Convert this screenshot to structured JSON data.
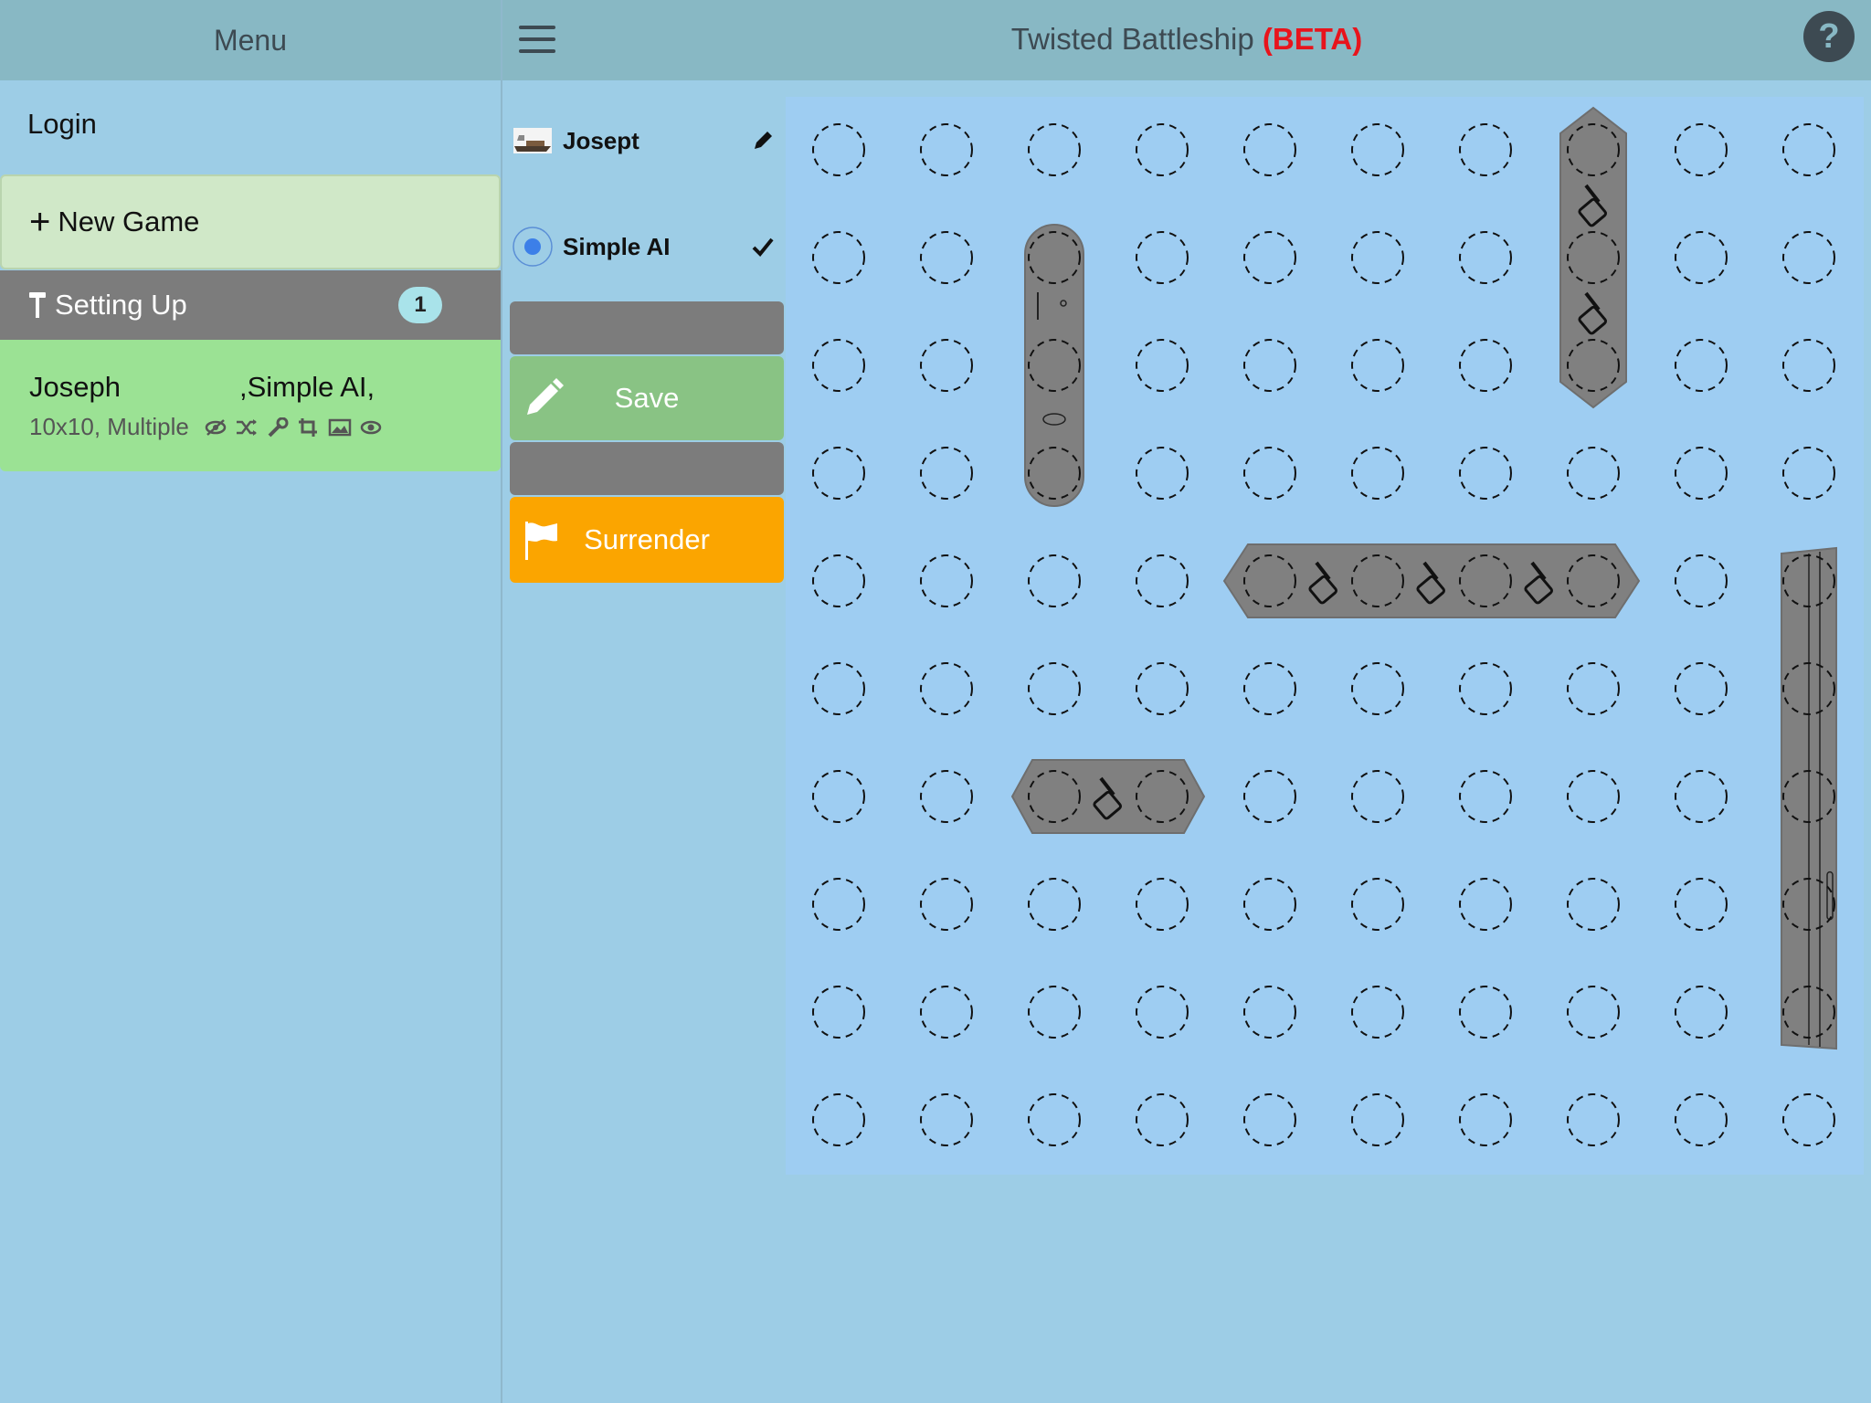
{
  "sidebar": {
    "header": "Menu",
    "login": "Login",
    "new_game": "New Game",
    "setting_up": {
      "label": "Setting Up",
      "count": "1"
    },
    "game_item": {
      "player1": "Joseph",
      "player2": ",Simple AI,",
      "details": "10x10, Multiple",
      "icons": [
        "eye-slash-icon",
        "shuffle-icon",
        "wrench-icon",
        "crop-icon",
        "image-icon",
        "eye-icon"
      ]
    }
  },
  "header": {
    "title": "Twisted Battleship",
    "beta": "(BETA)",
    "help": "?"
  },
  "players": [
    {
      "name": "Josept",
      "status_icon": "pencil-icon"
    },
    {
      "name": "Simple AI",
      "status_icon": "check-icon"
    }
  ],
  "actions": {
    "save": "Save",
    "surrender": "Surrender"
  },
  "board": {
    "rows": 10,
    "cols": 10,
    "ships": [
      {
        "name": "ship-vertical-col3",
        "orientation": "vertical",
        "col": 2,
        "row": 1,
        "length": 3,
        "style": "rounded"
      },
      {
        "name": "ship-vertical-col8",
        "orientation": "vertical",
        "col": 7,
        "row": 0,
        "length": 3,
        "style": "pointed"
      },
      {
        "name": "ship-horizontal-row5",
        "orientation": "horizontal",
        "col": 4,
        "row": 4,
        "length": 4,
        "style": "pointed"
      },
      {
        "name": "ship-horizontal-row7",
        "orientation": "horizontal",
        "col": 2,
        "row": 6,
        "length": 2,
        "style": "pointed"
      },
      {
        "name": "ship-vertical-col10",
        "orientation": "vertical",
        "col": 9,
        "row": 4,
        "length": 5,
        "style": "carrier"
      }
    ]
  },
  "colors": {
    "sidebar_bg": "#9dcde6",
    "header_bg": "#88b8c4",
    "board_bg": "#9ecdf2",
    "ship": "#808080",
    "save": "#89c384",
    "surrender": "#fba500",
    "beta": "#e8141c"
  }
}
